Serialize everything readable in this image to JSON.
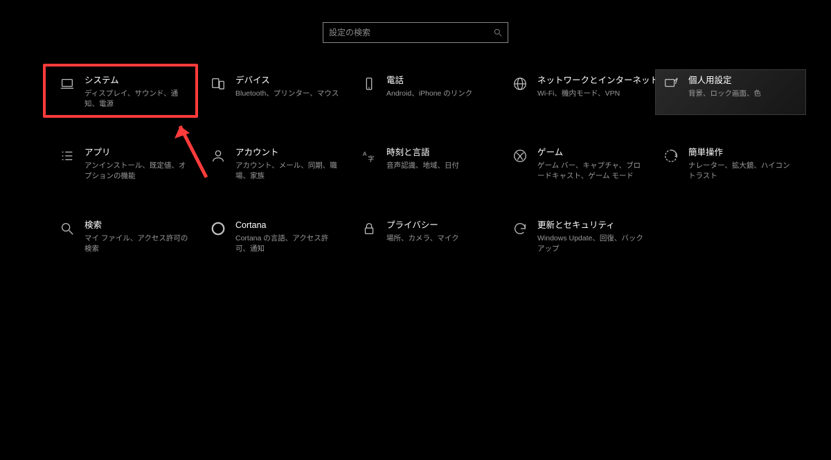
{
  "search": {
    "placeholder": "設定の検索"
  },
  "tiles": [
    {
      "id": "system",
      "title": "システム",
      "desc": "ディスプレイ、サウンド、通知、電源"
    },
    {
      "id": "devices",
      "title": "デバイス",
      "desc": "Bluetooth、プリンター、マウス"
    },
    {
      "id": "phone",
      "title": "電話",
      "desc": "Android、iPhone のリンク"
    },
    {
      "id": "network",
      "title": "ネットワークとインターネット",
      "desc": "Wi-Fi、機内モード、VPN"
    },
    {
      "id": "personalization",
      "title": "個人用設定",
      "desc": "背景、ロック画面、色"
    },
    {
      "id": "apps",
      "title": "アプリ",
      "desc": "アンインストール、既定値、オプションの機能"
    },
    {
      "id": "accounts",
      "title": "アカウント",
      "desc": "アカウント、メール、同期、職場、家族"
    },
    {
      "id": "time",
      "title": "時刻と言語",
      "desc": "音声認識、地域、日付"
    },
    {
      "id": "gaming",
      "title": "ゲーム",
      "desc": "ゲーム バー、キャプチャ、ブロードキャスト、ゲーム モード"
    },
    {
      "id": "ease",
      "title": "簡単操作",
      "desc": "ナレーター、拡大鏡、ハイコントラスト"
    },
    {
      "id": "search",
      "title": "検索",
      "desc": "マイ ファイル、アクセス許可の検索"
    },
    {
      "id": "cortana",
      "title": "Cortana",
      "desc": "Cortana の言語、アクセス許可、通知"
    },
    {
      "id": "privacy",
      "title": "プライバシー",
      "desc": "場所、カメラ、マイク"
    },
    {
      "id": "update",
      "title": "更新とセキュリティ",
      "desc": "Windows Update、回復、バックアップ"
    }
  ]
}
